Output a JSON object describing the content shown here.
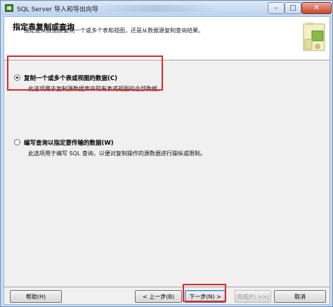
{
  "window": {
    "title": "SQL Server 导入和导出向导",
    "minimize_glyph": "–",
    "maximize_glyph": "□",
    "close_glyph": "✕"
  },
  "header": {
    "title": "指定表复制或查询",
    "subtitle": "指定是从数据源复制一个或多个表和视图，还是从数据源复制查询结果。",
    "graphic_icon": "wizard-graphic-icon"
  },
  "options": [
    {
      "label": "复制一个或多个表或视图的数据(C)",
      "description": "此选项用于复制源数据库中现有表或视图的全部数据。",
      "selected": true
    },
    {
      "label": "编写查询以指定要传输的数据(W)",
      "description": "此选项用于编写 SQL 查询，以便对复制操作的源数据进行操纵或限制。",
      "selected": false
    }
  ],
  "footer": {
    "help": "帮助(H)",
    "back": "< 上一步(B)",
    "next": "下一步(N) >",
    "finish": "完成(F) >>|",
    "cancel": "取消"
  },
  "colors": {
    "highlight": "#e0262b",
    "titlebar": "#c9dcf2"
  }
}
